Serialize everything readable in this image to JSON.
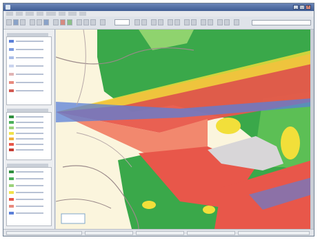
{
  "window": {
    "title": "",
    "controls": [
      {
        "name": "minimize",
        "glyph": "_"
      },
      {
        "name": "maximize",
        "glyph": "□"
      },
      {
        "name": "close",
        "glyph": "×"
      }
    ]
  },
  "colors": {
    "map_background": "#fbf5dd",
    "coverage_green": "#3aa84a",
    "coverage_light_green": "#8fd36e",
    "coverage_red": "#e8574a",
    "coverage_salmon": "#f2886e",
    "coverage_yellow": "#f2df3a",
    "coverage_blue": "#5a7fd8",
    "road_color": "#9b8a8a"
  },
  "icons": {
    "window_icon": "app-icon",
    "toolbar": [
      "open-icon",
      "save-icon",
      "print-icon",
      "zoom-in-icon",
      "zoom-out-icon",
      "pan-icon",
      "select-icon",
      "measure-icon",
      "layer-icon",
      "refresh-icon"
    ]
  },
  "sidebar": {
    "panels": [
      {
        "name": "legend-panel-top",
        "swatches": [
          "#5a7fd8",
          "#7d9be0",
          "#a9bde8",
          "#c9d3ee",
          "#e0b4b4",
          "#e88a7e",
          "#d25a52"
        ]
      },
      {
        "name": "legend-panel-middle",
        "swatches": [
          "#2f8f3f",
          "#4bb05a",
          "#9bd27a",
          "#f1e24a",
          "#f0b23c",
          "#e8574a",
          "#c63b33"
        ]
      },
      {
        "name": "legend-panel-bottom",
        "swatches": [
          "#2f8f3f",
          "#4bb05a",
          "#9bd27a",
          "#f1e24a",
          "#e8574a",
          "#e88a7e",
          "#5a7fd8"
        ]
      }
    ]
  }
}
